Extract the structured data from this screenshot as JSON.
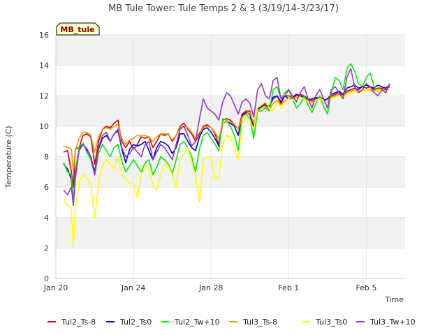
{
  "chart_data": {
    "type": "line",
    "title": "MB Tule Tower: Tule Temps 2 & 3 (3/19/14-3/23/17)",
    "badge": "MB_tule",
    "xlabel": "Time",
    "ylabel": "Temperature (C)",
    "xlim": [
      "Jan 20",
      "Feb 7"
    ],
    "x_unit": "days since Jan 20",
    "xlim_days": [
      0,
      18
    ],
    "ylim": [
      0,
      16
    ],
    "x_ticks": [
      {
        "label": "Jan 20",
        "day": 0
      },
      {
        "label": "Jan 24",
        "day": 4
      },
      {
        "label": "Jan 28",
        "day": 8
      },
      {
        "label": "Feb 1",
        "day": 12
      },
      {
        "label": "Feb 5",
        "day": 16
      }
    ],
    "y_ticks": [
      0,
      2,
      4,
      6,
      8,
      10,
      12,
      14,
      16
    ],
    "bands": "alternating light gray horizontal bands",
    "legend_position": "bottom",
    "series": [
      {
        "name": "Tul2_Ts-8",
        "color": "#dd0000",
        "x": [
          0.4,
          0.6,
          0.8,
          0.9,
          1.0,
          1.2,
          1.4,
          1.6,
          1.8,
          2.0,
          2.2,
          2.4,
          2.6,
          2.8,
          3.0,
          3.2,
          3.4,
          3.6,
          3.8,
          4.0,
          4.2,
          4.4,
          4.6,
          4.8,
          5.0,
          5.2,
          5.4,
          5.6,
          5.8,
          6.0,
          6.2,
          6.4,
          6.6,
          6.8,
          7.0,
          7.2,
          7.4,
          7.6,
          7.8,
          8.0,
          8.2,
          8.4,
          8.6,
          8.8,
          9.0,
          9.2,
          9.4,
          9.6,
          9.8,
          10.0,
          10.2,
          10.4,
          10.6,
          10.8,
          11.0,
          11.2,
          11.4,
          11.6,
          11.8,
          12.0,
          12.2,
          12.4,
          12.6,
          12.8,
          13.0,
          13.2,
          13.4,
          13.6,
          13.8,
          14.0,
          14.2,
          14.4,
          14.6,
          14.8,
          15.0,
          15.2,
          15.4,
          15.6,
          15.8,
          16.0,
          16.2,
          16.4,
          16.6,
          16.8,
          17.0,
          17.2
        ],
        "y": [
          8.3,
          8.4,
          7.0,
          6.0,
          8.5,
          8.6,
          9.4,
          9.5,
          9.3,
          7.5,
          9.0,
          9.8,
          10.0,
          9.9,
          10.2,
          10.4,
          9.0,
          8.6,
          9.0,
          8.5,
          8.8,
          9.3,
          9.2,
          9.3,
          8.6,
          9.0,
          9.5,
          9.4,
          9.5,
          9.0,
          9.4,
          10.0,
          10.2,
          9.8,
          9.5,
          9.0,
          9.5,
          10.0,
          10.1,
          9.9,
          9.5,
          8.8,
          10.4,
          10.5,
          10.4,
          10.1,
          9.8,
          10.8,
          11.0,
          11.0,
          10.0,
          11.2,
          11.4,
          11.5,
          11.3,
          11.8,
          12.0,
          11.5,
          12.0,
          12.0,
          11.9,
          12.0,
          12.1,
          12.0,
          11.8,
          11.7,
          11.8,
          11.9,
          11.8,
          11.6,
          12.0,
          12.1,
          12.2,
          12.0,
          12.3,
          12.4,
          12.5,
          12.4,
          12.6,
          12.5,
          12.6,
          12.4,
          12.5,
          12.5,
          12.4,
          12.6
        ]
      },
      {
        "name": "Tul2_Ts0",
        "color": "#0000cc",
        "x": [
          0.4,
          0.6,
          0.8,
          0.9,
          1.0,
          1.2,
          1.4,
          1.6,
          1.8,
          2.0,
          2.2,
          2.4,
          2.6,
          2.8,
          3.0,
          3.2,
          3.4,
          3.6,
          3.8,
          4.0,
          4.2,
          4.4,
          4.6,
          4.8,
          5.0,
          5.2,
          5.4,
          5.6,
          5.8,
          6.0,
          6.2,
          6.4,
          6.6,
          6.8,
          7.0,
          7.2,
          7.4,
          7.6,
          7.8,
          8.0,
          8.2,
          8.4,
          8.6,
          8.8,
          9.0,
          9.2,
          9.4,
          9.6,
          9.8,
          10.0,
          10.2,
          10.4,
          10.6,
          10.8,
          11.0,
          11.2,
          11.4,
          11.6,
          11.8,
          12.0,
          12.2,
          12.4,
          12.6,
          12.8,
          13.0,
          13.2,
          13.4,
          13.6,
          13.8,
          14.0,
          14.2,
          14.4,
          14.6,
          14.8,
          15.0,
          15.2,
          15.4,
          15.6,
          15.8,
          16.0,
          16.2,
          16.4,
          16.6,
          16.8,
          17.0,
          17.2
        ],
        "y": [
          7.5,
          7.2,
          6.5,
          4.8,
          7.0,
          8.5,
          8.8,
          8.5,
          8.0,
          7.0,
          8.5,
          9.2,
          9.4,
          9.0,
          9.5,
          9.7,
          8.5,
          7.6,
          8.5,
          8.8,
          8.7,
          8.8,
          9.0,
          8.4,
          7.8,
          8.6,
          9.0,
          8.9,
          8.7,
          8.2,
          8.6,
          9.5,
          9.5,
          9.0,
          8.6,
          8.4,
          9.3,
          9.8,
          9.9,
          9.6,
          9.2,
          8.7,
          10.2,
          10.3,
          10.2,
          10.0,
          9.4,
          10.7,
          10.9,
          10.8,
          9.8,
          11.1,
          11.3,
          11.4,
          11.2,
          11.9,
          12.0,
          11.6,
          12.0,
          11.8,
          11.9,
          12.1,
          12.0,
          11.9,
          11.7,
          11.8,
          11.9,
          11.8,
          11.7,
          11.8,
          12.1,
          12.2,
          12.3,
          12.1,
          12.5,
          12.6,
          12.7,
          12.5,
          12.6,
          12.7,
          12.6,
          12.5,
          12.7,
          12.6,
          12.5,
          12.7
        ]
      },
      {
        "name": "Tul2_Tw+10",
        "color": "#00ee00",
        "x": [
          0.4,
          0.6,
          0.8,
          0.9,
          1.0,
          1.2,
          1.4,
          1.6,
          1.8,
          2.0,
          2.2,
          2.4,
          2.6,
          2.8,
          3.0,
          3.2,
          3.4,
          3.6,
          3.8,
          4.0,
          4.2,
          4.4,
          4.6,
          4.8,
          5.0,
          5.2,
          5.4,
          5.6,
          5.8,
          6.0,
          6.2,
          6.4,
          6.6,
          6.8,
          7.0,
          7.2,
          7.4,
          7.6,
          7.8,
          8.0,
          8.2,
          8.4,
          8.6,
          8.8,
          9.0,
          9.2,
          9.4,
          9.6,
          9.8,
          10.0,
          10.2,
          10.4,
          10.6,
          10.8,
          11.0,
          11.2,
          11.4,
          11.6,
          11.8,
          12.0,
          12.2,
          12.4,
          12.6,
          12.8,
          13.0,
          13.2,
          13.4,
          13.6,
          13.8,
          14.0,
          14.2,
          14.4,
          14.6,
          14.8,
          15.0,
          15.2,
          15.4,
          15.6,
          15.8,
          16.0,
          16.2,
          16.4,
          16.6,
          16.8,
          17.0,
          17.2
        ],
        "y": [
          7.6,
          7.0,
          6.8,
          5.0,
          6.8,
          8.6,
          8.9,
          8.3,
          7.8,
          6.8,
          8.2,
          8.8,
          8.4,
          8.0,
          8.6,
          8.8,
          7.7,
          7.0,
          7.4,
          7.8,
          7.4,
          7.0,
          7.6,
          7.8,
          6.8,
          7.3,
          8.0,
          7.8,
          7.5,
          6.9,
          7.8,
          8.8,
          9.0,
          8.6,
          8.0,
          7.0,
          8.5,
          9.4,
          9.6,
          9.2,
          8.8,
          8.4,
          10.5,
          10.4,
          10.0,
          9.4,
          8.4,
          10.6,
          10.8,
          10.5,
          9.2,
          11.0,
          11.0,
          11.2,
          11.0,
          12.4,
          12.6,
          11.8,
          12.2,
          12.4,
          11.8,
          11.2,
          11.5,
          12.0,
          11.4,
          10.9,
          11.5,
          12.0,
          11.3,
          10.8,
          12.2,
          13.2,
          13.0,
          12.4,
          13.8,
          14.1,
          13.6,
          12.8,
          12.6,
          13.2,
          13.5,
          12.6,
          12.3,
          12.4,
          12.2,
          12.8
        ]
      },
      {
        "name": "Tul3_Ts-8",
        "color": "#ee9900",
        "x": [
          0.4,
          0.6,
          0.8,
          0.9,
          1.0,
          1.2,
          1.4,
          1.6,
          1.8,
          2.0,
          2.2,
          2.4,
          2.6,
          2.8,
          3.0,
          3.2,
          3.4,
          3.6,
          3.8,
          4.0,
          4.2,
          4.4,
          4.6,
          4.8,
          5.0,
          5.2,
          5.4,
          5.6,
          5.8,
          6.0,
          6.2,
          6.4,
          6.6,
          6.8,
          7.0,
          7.2,
          7.4,
          7.6,
          7.8,
          8.0,
          8.2,
          8.4,
          8.6,
          8.8,
          9.0,
          9.2,
          9.4,
          9.6,
          9.8,
          10.0,
          10.2,
          10.4,
          10.6,
          10.8,
          11.0,
          11.2,
          11.4,
          11.6,
          11.8,
          12.0,
          12.2,
          12.4,
          12.6,
          12.8,
          13.0,
          13.2,
          13.4,
          13.6,
          13.8,
          14.0,
          14.2,
          14.4,
          14.6,
          14.8,
          15.0,
          15.2,
          15.4,
          15.6,
          15.8,
          16.0,
          16.2,
          16.4,
          16.6,
          16.8,
          17.0,
          17.2
        ],
        "y": [
          8.7,
          8.6,
          8.5,
          7.0,
          8.4,
          9.2,
          9.6,
          9.6,
          9.4,
          8.3,
          9.3,
          9.8,
          9.9,
          9.8,
          10.0,
          10.1,
          9.2,
          8.8,
          9.1,
          9.2,
          9.4,
          9.4,
          9.4,
          9.3,
          9.0,
          9.3,
          9.5,
          9.5,
          9.5,
          9.1,
          9.4,
          9.9,
          10.0,
          9.9,
          9.6,
          9.2,
          9.6,
          9.9,
          10.0,
          9.9,
          9.6,
          9.2,
          10.2,
          10.3,
          10.3,
          10.1,
          9.8,
          10.6,
          10.8,
          10.9,
          10.2,
          11.0,
          11.2,
          11.3,
          11.1,
          11.5,
          11.7,
          11.4,
          11.7,
          11.8,
          11.8,
          11.9,
          11.9,
          11.8,
          11.7,
          11.6,
          11.7,
          11.8,
          11.7,
          11.6,
          11.9,
          12.0,
          12.1,
          12.0,
          12.2,
          12.3,
          12.4,
          12.3,
          12.4,
          12.4,
          12.4,
          12.3,
          12.4,
          12.4,
          12.3,
          12.4
        ]
      },
      {
        "name": "Tul3_Ts0",
        "color": "#ffff00",
        "x": [
          0.4,
          0.6,
          0.8,
          0.9,
          1.0,
          1.2,
          1.4,
          1.6,
          1.8,
          2.0,
          2.2,
          2.4,
          2.6,
          2.8,
          3.0,
          3.2,
          3.4,
          3.6,
          3.8,
          4.0,
          4.2,
          4.4,
          4.6,
          4.8,
          5.0,
          5.2,
          5.4,
          5.6,
          5.8,
          6.0,
          6.2,
          6.4,
          6.6,
          6.8,
          7.0,
          7.2,
          7.4,
          7.6,
          7.8,
          8.0,
          8.2,
          8.4,
          8.6,
          8.8,
          9.0,
          9.2,
          9.4,
          9.6,
          9.8,
          10.0,
          10.2,
          10.4,
          10.6,
          10.8,
          11.0,
          11.2,
          11.4,
          11.6,
          11.8,
          12.0,
          12.2,
          12.4,
          12.6,
          12.8,
          13.0,
          13.2,
          13.4,
          13.6,
          13.8,
          14.0,
          14.2,
          14.4,
          14.6,
          14.8,
          15.0,
          15.2,
          15.4,
          15.6,
          15.8,
          16.0,
          16.2,
          16.4,
          16.6,
          16.8,
          17.0,
          17.2
        ],
        "y": [
          5.2,
          4.8,
          4.6,
          2.0,
          4.5,
          6.4,
          6.8,
          6.6,
          6.2,
          4.0,
          6.2,
          7.4,
          7.8,
          7.5,
          7.2,
          8.0,
          6.8,
          6.5,
          6.3,
          6.2,
          5.3,
          6.8,
          7.4,
          7.2,
          6.2,
          5.8,
          6.8,
          7.5,
          7.4,
          6.8,
          6.0,
          7.8,
          8.2,
          8.6,
          7.6,
          6.8,
          5.0,
          7.8,
          8.0,
          7.9,
          6.5,
          6.6,
          8.8,
          9.4,
          9.3,
          8.5,
          7.8,
          10.2,
          10.6,
          10.4,
          9.8,
          11.2,
          11.4,
          11.6,
          11.2,
          11.0,
          11.6,
          11.2,
          11.6,
          11.8,
          11.7,
          11.8,
          11.9,
          11.8,
          11.6,
          11.5,
          11.7,
          11.8,
          11.7,
          11.6,
          11.8,
          11.9,
          12.0,
          11.9,
          12.1,
          12.2,
          12.3,
          12.2,
          12.3,
          12.4,
          12.3,
          12.2,
          12.4,
          12.3,
          12.3,
          12.4
        ]
      },
      {
        "name": "Tul3_Tw+10",
        "color": "#9933cc",
        "x": [
          0.4,
          0.6,
          0.8,
          0.9,
          1.0,
          1.2,
          1.4,
          1.6,
          1.8,
          2.0,
          2.2,
          2.4,
          2.6,
          2.8,
          3.0,
          3.2,
          3.4,
          3.6,
          3.8,
          4.0,
          4.2,
          4.4,
          4.6,
          4.8,
          5.0,
          5.2,
          5.4,
          5.6,
          5.8,
          6.0,
          6.2,
          6.4,
          6.6,
          6.8,
          7.0,
          7.2,
          7.4,
          7.6,
          7.8,
          8.0,
          8.2,
          8.4,
          8.6,
          8.8,
          9.0,
          9.2,
          9.4,
          9.6,
          9.8,
          10.0,
          10.2,
          10.4,
          10.6,
          10.8,
          11.0,
          11.2,
          11.4,
          11.6,
          11.8,
          12.0,
          12.2,
          12.4,
          12.6,
          12.8,
          13.0,
          13.2,
          13.4,
          13.6,
          13.8,
          14.0,
          14.2,
          14.4,
          14.6,
          14.8,
          15.0,
          15.2,
          15.4,
          15.6,
          15.8,
          16.0,
          16.2,
          16.4,
          16.6,
          16.8,
          17.0,
          17.2
        ],
        "y": [
          5.8,
          5.5,
          6.0,
          4.8,
          6.5,
          8.4,
          8.8,
          8.4,
          8.0,
          6.8,
          8.6,
          9.4,
          9.6,
          9.0,
          9.5,
          9.8,
          8.6,
          8.0,
          8.2,
          8.6,
          8.3,
          8.0,
          8.8,
          9.0,
          7.8,
          8.3,
          8.8,
          8.6,
          8.2,
          7.8,
          8.8,
          9.8,
          10.0,
          9.4,
          8.7,
          9.0,
          10.5,
          11.8,
          11.2,
          11.0,
          10.8,
          10.4,
          11.6,
          12.2,
          12.0,
          11.4,
          10.8,
          11.6,
          11.8,
          11.5,
          10.6,
          12.4,
          12.8,
          12.0,
          11.8,
          13.0,
          13.2,
          11.8,
          12.0,
          12.4,
          12.0,
          11.6,
          12.2,
          12.6,
          11.8,
          11.2,
          12.0,
          12.4,
          11.8,
          11.2,
          12.4,
          12.6,
          12.2,
          11.8,
          13.2,
          13.8,
          12.6,
          12.2,
          12.4,
          12.8,
          12.6,
          12.2,
          12.0,
          12.4,
          12.2,
          12.8
        ]
      }
    ]
  }
}
